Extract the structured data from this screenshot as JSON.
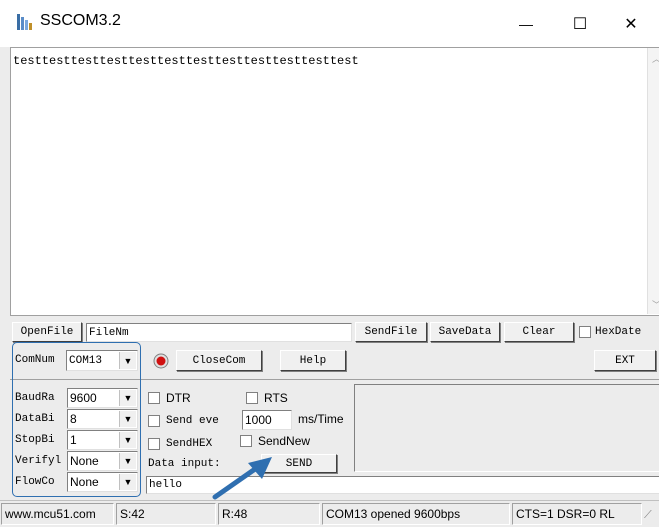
{
  "window": {
    "title": "SSCOM3.2",
    "icon": "sscom-app-icon",
    "minimize_glyph": "—",
    "maximize_glyph": "☐",
    "close_glyph": "✕"
  },
  "receive": {
    "text": "testtesttesttesttesttesttesttesttesttesttesttest"
  },
  "toolbar": {
    "open_file": "OpenFile",
    "file_name_value": "FileNm",
    "send_file": "SendFile",
    "save_data": "SaveData",
    "clear": "Clear",
    "hex_data": "HexDate"
  },
  "port": {
    "com_num_label": "ComNum",
    "com_num_value": "COM13",
    "status_color": "#d01010",
    "close_com": "CloseCom",
    "help": "Help",
    "ext": "EXT"
  },
  "settings": {
    "baud_label": "BaudRa",
    "baud_value": "9600",
    "data_bits_label": "DataBi",
    "data_bits_value": "8",
    "stop_bits_label": "StopBi",
    "stop_bits_value": "1",
    "verify_label": "Verifyl",
    "verify_value": "None",
    "flow_label": "FlowCo",
    "flow_value": "None"
  },
  "options": {
    "dtr": "DTR",
    "rts": "RTS",
    "send_every": "Send eve",
    "interval_value": "1000",
    "interval_unit": "ms/Time",
    "send_hex": "SendHEX",
    "send_new": "SendNew",
    "data_input_label": "Data input:",
    "send": "SEND",
    "input_value": "hello"
  },
  "status": {
    "site": "www.mcu51.com",
    "sent": "S:42",
    "received": "R:48",
    "port_state": "COM13 opened 9600bps",
    "lines": "CTS=1 DSR=0 RL"
  },
  "annotation": {
    "color": "#2f6fb0"
  }
}
